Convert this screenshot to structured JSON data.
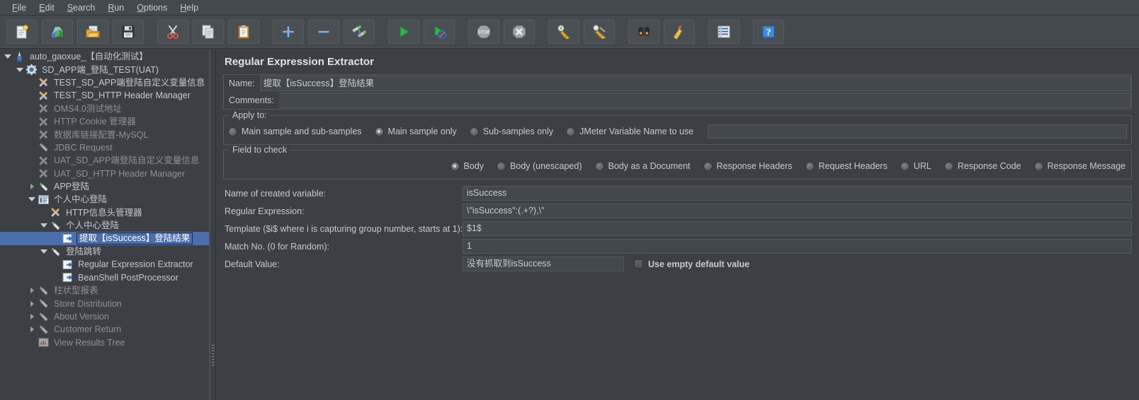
{
  "menubar": {
    "items": [
      {
        "label": "File",
        "mnemonic": "F"
      },
      {
        "label": "Edit",
        "mnemonic": "E"
      },
      {
        "label": "Search",
        "mnemonic": "S"
      },
      {
        "label": "Run",
        "mnemonic": "R"
      },
      {
        "label": "Options",
        "mnemonic": "O"
      },
      {
        "label": "Help",
        "mnemonic": "H"
      }
    ]
  },
  "toolbar": {
    "buttons": [
      {
        "icon": "new-document-icon",
        "tooltip": "New"
      },
      {
        "icon": "templates-icon",
        "tooltip": "Templates"
      },
      {
        "icon": "open-folder-icon",
        "tooltip": "Open"
      },
      {
        "icon": "save-floppy-icon",
        "tooltip": "Save Test Plan"
      },
      {
        "icon": "cut-scissors-icon",
        "tooltip": "Cut"
      },
      {
        "icon": "copy-pages-icon",
        "tooltip": "Copy"
      },
      {
        "icon": "paste-clipboard-icon",
        "tooltip": "Paste"
      },
      {
        "icon": "plus-expand-icon",
        "tooltip": "Expand All"
      },
      {
        "icon": "minus-collapse-icon",
        "tooltip": "Collapse All"
      },
      {
        "icon": "toggle-element-icon",
        "tooltip": "Toggle"
      },
      {
        "icon": "start-play-icon",
        "tooltip": "Start"
      },
      {
        "icon": "start-no-pauses-icon",
        "tooltip": "Start no pauses"
      },
      {
        "icon": "stop-sign-icon",
        "tooltip": "Stop"
      },
      {
        "icon": "shutdown-icon",
        "tooltip": "Shutdown"
      },
      {
        "icon": "clear-broom-icon",
        "tooltip": "Clear"
      },
      {
        "icon": "clear-all-broom-icon",
        "tooltip": "Clear All"
      },
      {
        "icon": "binoculars-search-icon",
        "tooltip": "Search"
      },
      {
        "icon": "reset-search-broom-icon",
        "tooltip": "Reset Search"
      },
      {
        "icon": "function-helper-icon",
        "tooltip": "Function Helper Dialog"
      },
      {
        "icon": "help-question-icon",
        "tooltip": "Help"
      }
    ]
  },
  "tree": {
    "nodes": [
      {
        "label": "auto_gaoxue_【自动化测试】",
        "indent": 0,
        "icon": "test-plan-icon",
        "toggle": "open",
        "disabled": false,
        "selected": false
      },
      {
        "label": "SD_APP端_登陆_TEST(UAT)",
        "indent": 1,
        "icon": "thread-group-icon",
        "toggle": "open",
        "disabled": false,
        "selected": false
      },
      {
        "label": "TEST_SD_APP端登陆自定义变量信息",
        "indent": 2,
        "icon": "config-element-icon",
        "toggle": "none",
        "disabled": false,
        "selected": false
      },
      {
        "label": "TEST_SD_HTTP Header Manager",
        "indent": 2,
        "icon": "config-element-icon",
        "toggle": "none",
        "disabled": false,
        "selected": false
      },
      {
        "label": "OMS4.0测试地址",
        "indent": 2,
        "icon": "config-element-disabled-icon",
        "toggle": "none",
        "disabled": true,
        "selected": false
      },
      {
        "label": "HTTP Cookie 管理器",
        "indent": 2,
        "icon": "config-element-disabled-icon",
        "toggle": "none",
        "disabled": true,
        "selected": false
      },
      {
        "label": "数据库链接配置-MySQL",
        "indent": 2,
        "icon": "config-element-disabled-icon",
        "toggle": "none",
        "disabled": true,
        "selected": false
      },
      {
        "label": "JDBC Request",
        "indent": 2,
        "icon": "sampler-disabled-icon",
        "toggle": "none",
        "disabled": true,
        "selected": false
      },
      {
        "label": "UAT_SD_APP端登陆自定义变量信息",
        "indent": 2,
        "icon": "config-element-disabled-icon",
        "toggle": "none",
        "disabled": true,
        "selected": false
      },
      {
        "label": "UAT_SD_HTTP Header Manager",
        "indent": 2,
        "icon": "config-element-disabled-icon",
        "toggle": "none",
        "disabled": true,
        "selected": false
      },
      {
        "label": "APP登陆",
        "indent": 2,
        "icon": "sampler-icon",
        "toggle": "closed",
        "disabled": false,
        "selected": false
      },
      {
        "label": "个人中心登陆",
        "indent": 2,
        "icon": "transaction-controller-icon",
        "toggle": "open",
        "disabled": false,
        "selected": false
      },
      {
        "label": "HTTP信息头管理器",
        "indent": 3,
        "icon": "config-element-icon",
        "toggle": "none",
        "disabled": false,
        "selected": false
      },
      {
        "label": "个人中心登陆",
        "indent": 3,
        "icon": "sampler-icon",
        "toggle": "open",
        "disabled": false,
        "selected": false
      },
      {
        "label": "提取【isSuccess】登陆结果",
        "indent": 4,
        "icon": "post-processor-icon",
        "toggle": "none",
        "disabled": false,
        "selected": true
      },
      {
        "label": "登陆跳转",
        "indent": 3,
        "icon": "sampler-icon",
        "toggle": "open",
        "disabled": false,
        "selected": false
      },
      {
        "label": "Regular Expression Extractor",
        "indent": 4,
        "icon": "post-processor-icon",
        "toggle": "none",
        "disabled": false,
        "selected": false
      },
      {
        "label": "BeanShell PostProcessor",
        "indent": 4,
        "icon": "post-processor-icon",
        "toggle": "none",
        "disabled": false,
        "selected": false
      },
      {
        "label": "柱状型报表",
        "indent": 2,
        "icon": "sampler-disabled-icon",
        "toggle": "closed",
        "disabled": true,
        "selected": false
      },
      {
        "label": "Store Distribution",
        "indent": 2,
        "icon": "sampler-disabled-icon",
        "toggle": "closed",
        "disabled": true,
        "selected": false
      },
      {
        "label": "About Version",
        "indent": 2,
        "icon": "sampler-disabled-icon",
        "toggle": "closed",
        "disabled": true,
        "selected": false
      },
      {
        "label": "Customer Return",
        "indent": 2,
        "icon": "sampler-disabled-icon",
        "toggle": "closed",
        "disabled": true,
        "selected": false
      },
      {
        "label": "View Results Tree",
        "indent": 2,
        "icon": "listener-disabled-icon",
        "toggle": "none",
        "disabled": true,
        "selected": false
      }
    ]
  },
  "panel": {
    "title": "Regular Expression Extractor",
    "name_label": "Name:",
    "name_value": "提取【isSuccess】登陆结果",
    "comments_label": "Comments:",
    "comments_value": "",
    "apply_to": {
      "legend": "Apply to:",
      "options": [
        {
          "label": "Main sample and sub-samples",
          "checked": false
        },
        {
          "label": "Main sample only",
          "checked": true
        },
        {
          "label": "Sub-samples only",
          "checked": false
        },
        {
          "label": "JMeter Variable Name to use",
          "checked": false
        }
      ],
      "variable_value": ""
    },
    "field_to_check": {
      "legend": "Field to check",
      "options": [
        {
          "label": "Body",
          "checked": true
        },
        {
          "label": "Body (unescaped)",
          "checked": false
        },
        {
          "label": "Body as a Document",
          "checked": false
        },
        {
          "label": "Response Headers",
          "checked": false
        },
        {
          "label": "Request Headers",
          "checked": false
        },
        {
          "label": "URL",
          "checked": false
        },
        {
          "label": "Response Code",
          "checked": false
        },
        {
          "label": "Response Message",
          "checked": false
        }
      ]
    },
    "properties": [
      {
        "label": "Name of created variable:",
        "value": "isSuccess"
      },
      {
        "label": "Regular Expression:",
        "value": "\\\"isSuccess\":(.+?),\\\""
      },
      {
        "label": "Template ($i$ where i is capturing group number, starts at 1):",
        "value": "$1$"
      },
      {
        "label": "Match No. (0 for Random):",
        "value": "1"
      }
    ],
    "default_value": {
      "label": "Default Value:",
      "value": "没有抓取到isSuccess",
      "checkbox_label": "Use empty default value",
      "checked": false
    }
  },
  "colors": {
    "window_bg": "#3c4044",
    "chrome_bg": "#44494d",
    "text": "#c6cacf",
    "text_disabled": "#8d9196",
    "selection": "#4a6fae",
    "border": "#53585c"
  }
}
